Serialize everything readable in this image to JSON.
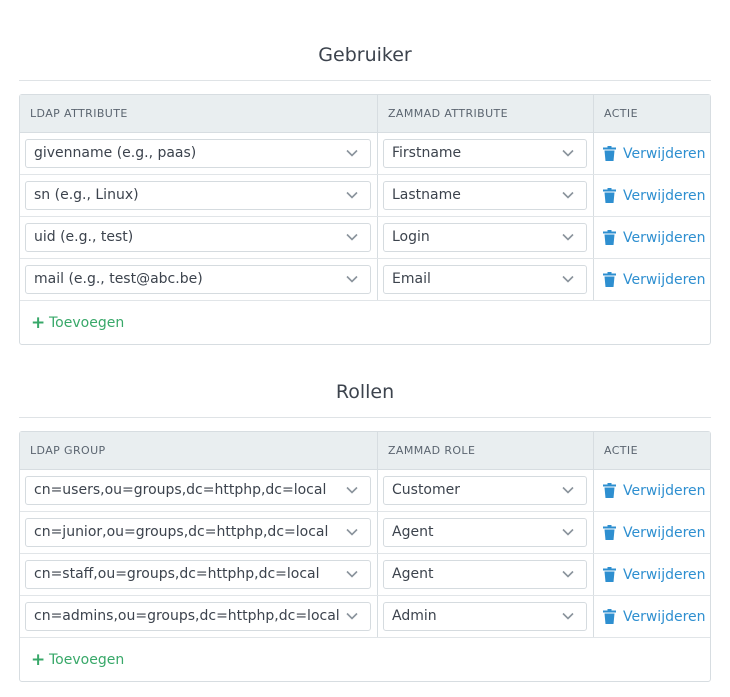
{
  "gebruiker": {
    "title": "Gebruiker",
    "headers": [
      "LDAP ATTRIBUTE",
      "ZAMMAD ATTRIBUTE",
      "ACTIE"
    ],
    "rows": [
      {
        "ldap": "givenname (e.g., paas)",
        "zammad": "Firstname",
        "action": "Verwijderen"
      },
      {
        "ldap": "sn (e.g., Linux)",
        "zammad": "Lastname",
        "action": "Verwijderen"
      },
      {
        "ldap": "uid (e.g., test)",
        "zammad": "Login",
        "action": "Verwijderen"
      },
      {
        "ldap": "mail (e.g., test@abc.be)",
        "zammad": "Email",
        "action": "Verwijderen"
      }
    ],
    "add_label": "Toevoegen"
  },
  "rollen": {
    "title": "Rollen",
    "headers": [
      "LDAP GROUP",
      "ZAMMAD ROLE",
      "ACTIE"
    ],
    "rows": [
      {
        "ldap": "cn=users,ou=groups,dc=httphp,dc=local",
        "zammad": "Customer",
        "action": "Verwijderen"
      },
      {
        "ldap": "cn=junior,ou=groups,dc=httphp,dc=local",
        "zammad": "Agent",
        "action": "Verwijderen"
      },
      {
        "ldap": "cn=staff,ou=groups,dc=httphp,dc=local",
        "zammad": "Agent",
        "action": "Verwijderen"
      },
      {
        "ldap": "cn=admins,ou=groups,dc=httphp,dc=local",
        "zammad": "Admin",
        "action": "Verwijderen"
      }
    ],
    "add_label": "Toevoegen"
  },
  "icons": {
    "delete": "trash-icon",
    "add": "plus-icon",
    "dropdown": "chevron-down-icon"
  },
  "colors": {
    "link": "#2e8fd0",
    "add": "#38a869",
    "header_bg": "#e9eef0"
  }
}
